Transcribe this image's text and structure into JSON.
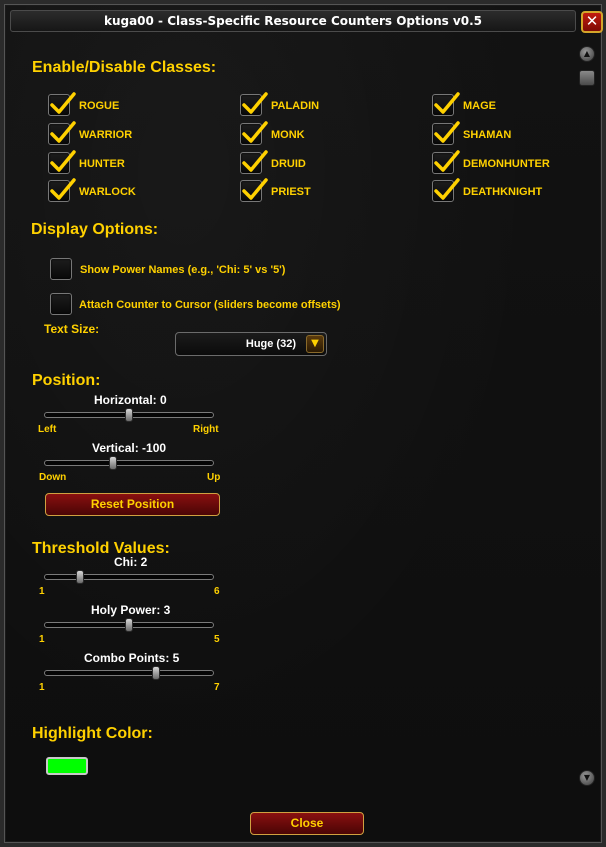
{
  "window": {
    "title": "kuga00 - Class-Specific Resource Counters  Options v0.5",
    "close_glyph": "✕"
  },
  "sections": {
    "classes": "Enable/Disable Classes:",
    "display": "Display Options:",
    "position": "Position:",
    "threshold": "Threshold Values:",
    "highlight": "Highlight Color:"
  },
  "classes": [
    {
      "label": "ROGUE",
      "checked": true
    },
    {
      "label": "PALADIN",
      "checked": true
    },
    {
      "label": "MAGE",
      "checked": true
    },
    {
      "label": "WARRIOR",
      "checked": true
    },
    {
      "label": "MONK",
      "checked": true
    },
    {
      "label": "SHAMAN",
      "checked": true
    },
    {
      "label": "HUNTER",
      "checked": true
    },
    {
      "label": "DRUID",
      "checked": true
    },
    {
      "label": "DEMONHUNTER",
      "checked": true
    },
    {
      "label": "WARLOCK",
      "checked": true
    },
    {
      "label": "PRIEST",
      "checked": true
    },
    {
      "label": "DEATHKNIGHT",
      "checked": true
    }
  ],
  "display_options": {
    "show_power_names": {
      "label": "Show Power Names (e.g., 'Chi: 5' vs '5')",
      "checked": false
    },
    "attach_cursor": {
      "label": "Attach Counter to Cursor (sliders become offsets)",
      "checked": false
    },
    "text_size_label": "Text Size:",
    "text_size_value": "Huge (32)"
  },
  "position": {
    "horizontal": {
      "label": "Horizontal: 0",
      "min_label": "Left",
      "max_label": "Right",
      "value": 0,
      "min": -500,
      "max": 500
    },
    "vertical": {
      "label": "Vertical: -100",
      "min_label": "Down",
      "max_label": "Up",
      "value": -100,
      "min": -500,
      "max": 500
    },
    "reset_label": "Reset Position"
  },
  "thresholds": {
    "chi": {
      "label": "Chi: 2",
      "min_label": "1",
      "max_label": "6",
      "value": 2,
      "min": 1,
      "max": 6
    },
    "holy_power": {
      "label": "Holy Power: 3",
      "min_label": "1",
      "max_label": "5",
      "value": 3,
      "min": 1,
      "max": 5
    },
    "combo_points": {
      "label": "Combo Points: 5",
      "min_label": "1",
      "max_label": "7",
      "value": 5,
      "min": 1,
      "max": 7
    }
  },
  "highlight_color": "#00ff00",
  "colors": {
    "gold": "#ffd100",
    "button_red": "#8a1010"
  },
  "footer": {
    "close_label": "Close"
  },
  "icons": {
    "check": "checkmark-icon",
    "dropdown": "chevron-down-icon",
    "close": "close-icon"
  }
}
